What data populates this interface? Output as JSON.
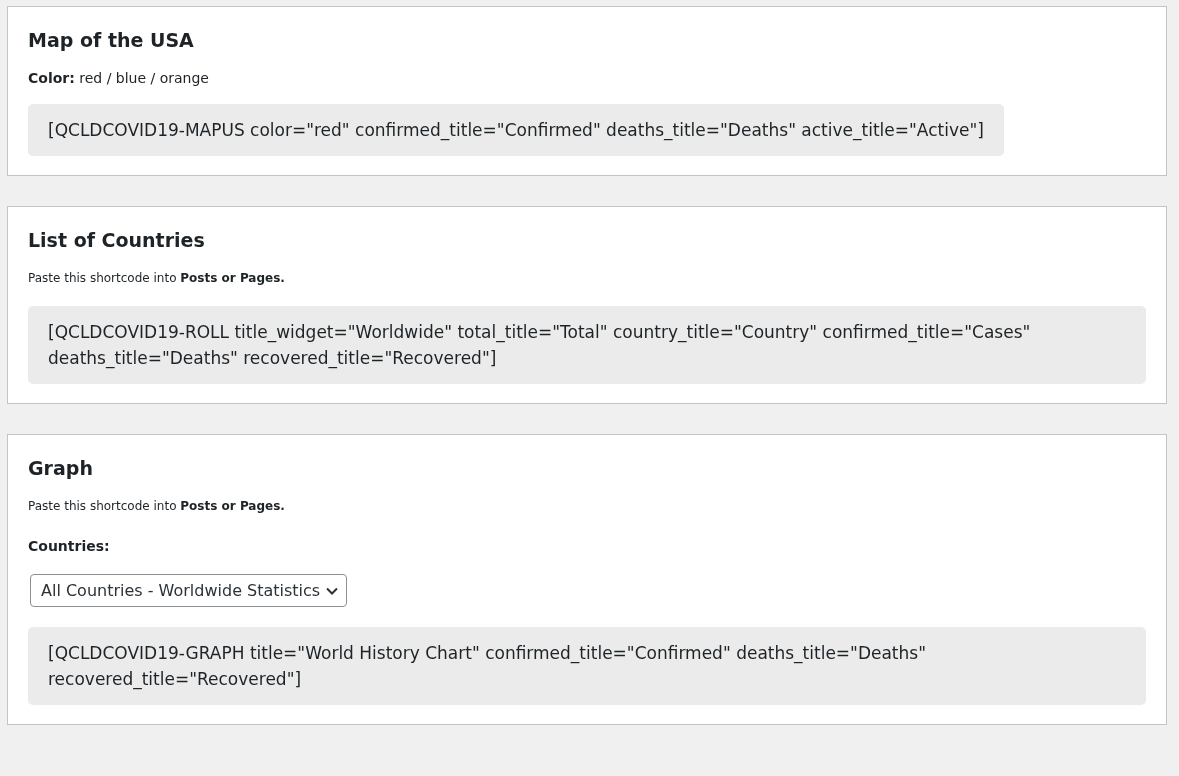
{
  "sections": [
    {
      "title": "Map of the USA",
      "description": {
        "kind": "legend",
        "text": "**Color:** red / blue / orange"
      },
      "shortcode": {
        "kind": "inline",
        "text": "[QCLDCOVID19-MAPUS color=\"red\" confirmed_title=\"Confirmed\" deaths_title=\"Deaths\" active_title=\"Active\"]"
      }
    },
    {
      "title": "List of Countries",
      "description": {
        "kind": "hint",
        "text": "Paste this shortcode into **Posts or Pages.**"
      },
      "shortcode": {
        "kind": "block",
        "text": "[QCLDCOVID19-ROLL title_widget=\"Worldwide\" total_title=\"Total\" country_title=\"Country\" confirmed_title=\"Cases\" deaths_title=\"Deaths\" recovered_title=\"Recovered\"]"
      }
    },
    {
      "title": "Graph",
      "description": {
        "kind": "hint",
        "text": "Paste this shortcode into **Posts or Pages.**"
      },
      "field": {
        "label": "Countries:",
        "value": "All Countries - Worldwide Statistics"
      },
      "shortcode": {
        "kind": "block",
        "text": "[QCLDCOVID19-GRAPH title=\"World History Chart\" confirmed_title=\"Confirmed\" deaths_title=\"Deaths\" recovered_title=\"Recovered\"]"
      }
    }
  ]
}
